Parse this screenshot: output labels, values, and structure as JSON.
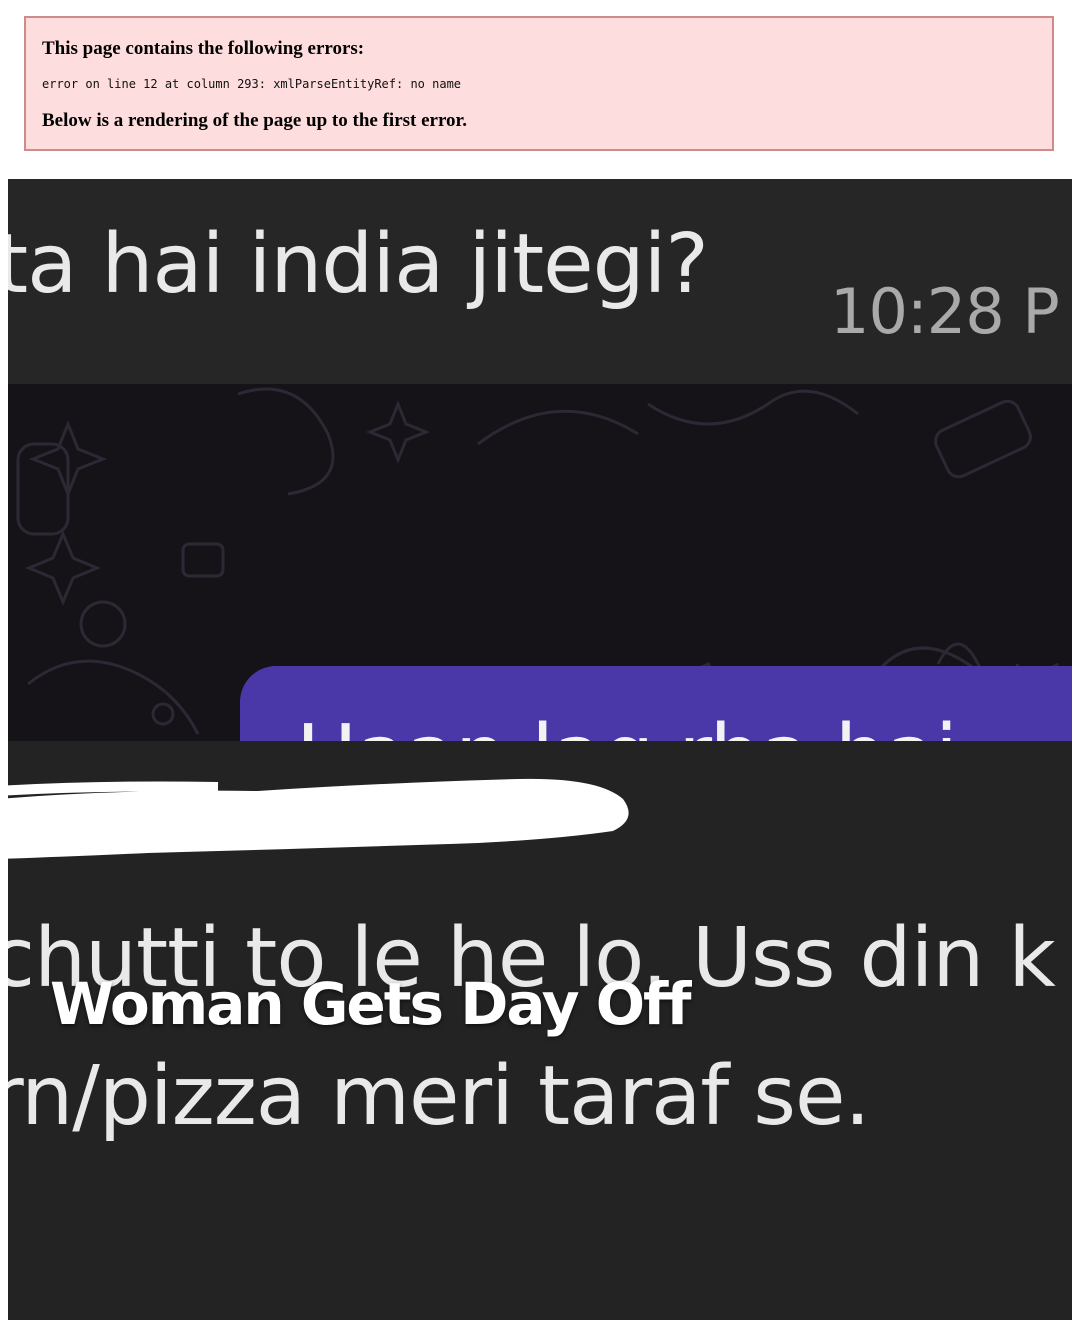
{
  "parser_error": {
    "heading": "This page contains the following errors:",
    "detail": "error on line 12 at column 293: xmlParseEntityRef: no name",
    "footer": "Below is a rendering of the page up to the first error.",
    "background_color": "#fddddd",
    "border_color": "#d08a8a"
  },
  "hero_image": {
    "question_line": "ta hai india jitegi?",
    "timestamp": "10:28 P",
    "bubble_text": "Haan lag rha hai",
    "bubble_color": "#4a38a8",
    "message_line_1": "chutti to le he lo. Uss din k",
    "message_line_2": "rn/pizza meri taraf se."
  },
  "article": {
    "title": "Woman Gets Day Off"
  }
}
